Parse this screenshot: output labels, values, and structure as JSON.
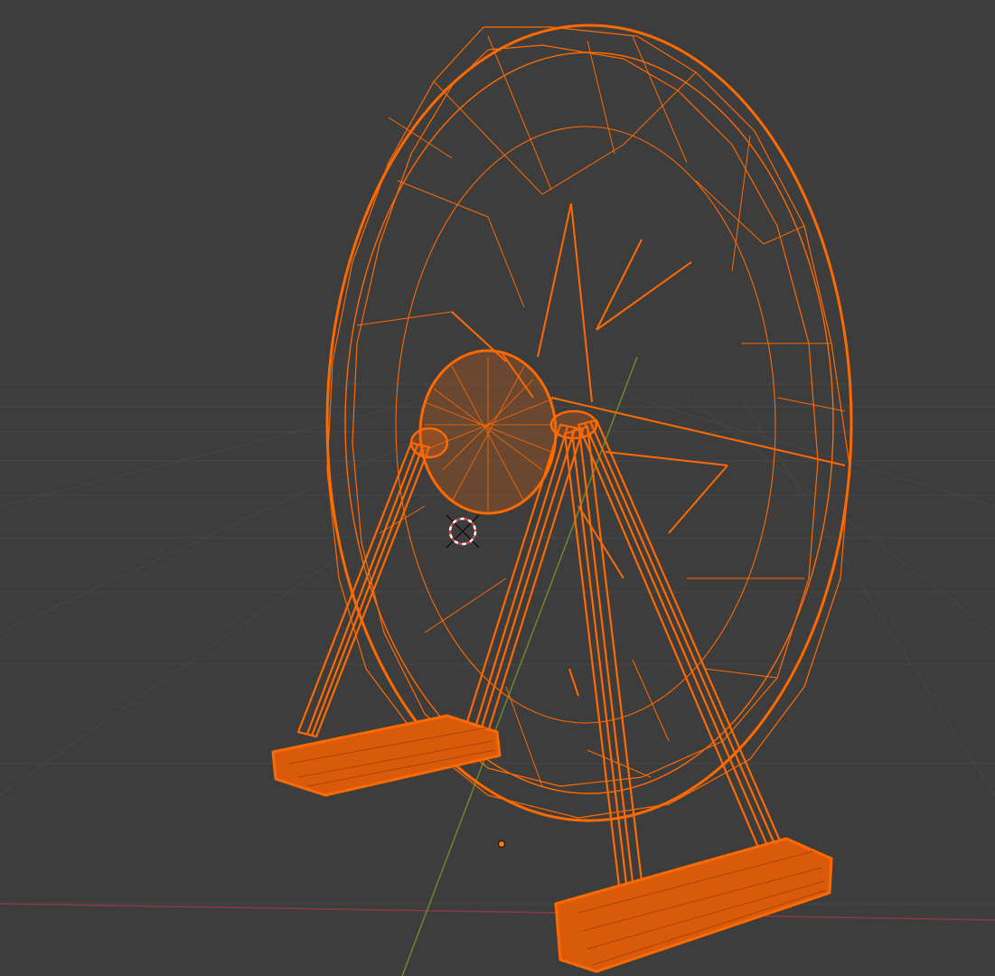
{
  "viewport": {
    "mode": "wireframe",
    "colors": {
      "background": "#3d3d3d",
      "grid_line": "#4a4a4a",
      "x_axis": "#8b3a45",
      "y_axis": "#6a8a2a",
      "selection_outline": "#ff6a00",
      "selection_fill": "#e06010",
      "origin_dot": "#ff7a00",
      "cursor_red": "#d94040",
      "cursor_white": "#ffffff"
    },
    "object": {
      "name_icon": "ferris-wheel-mesh",
      "selected": true
    },
    "cursor_icon": "3d-cursor-icon",
    "origin_icon": "object-origin-icon"
  }
}
